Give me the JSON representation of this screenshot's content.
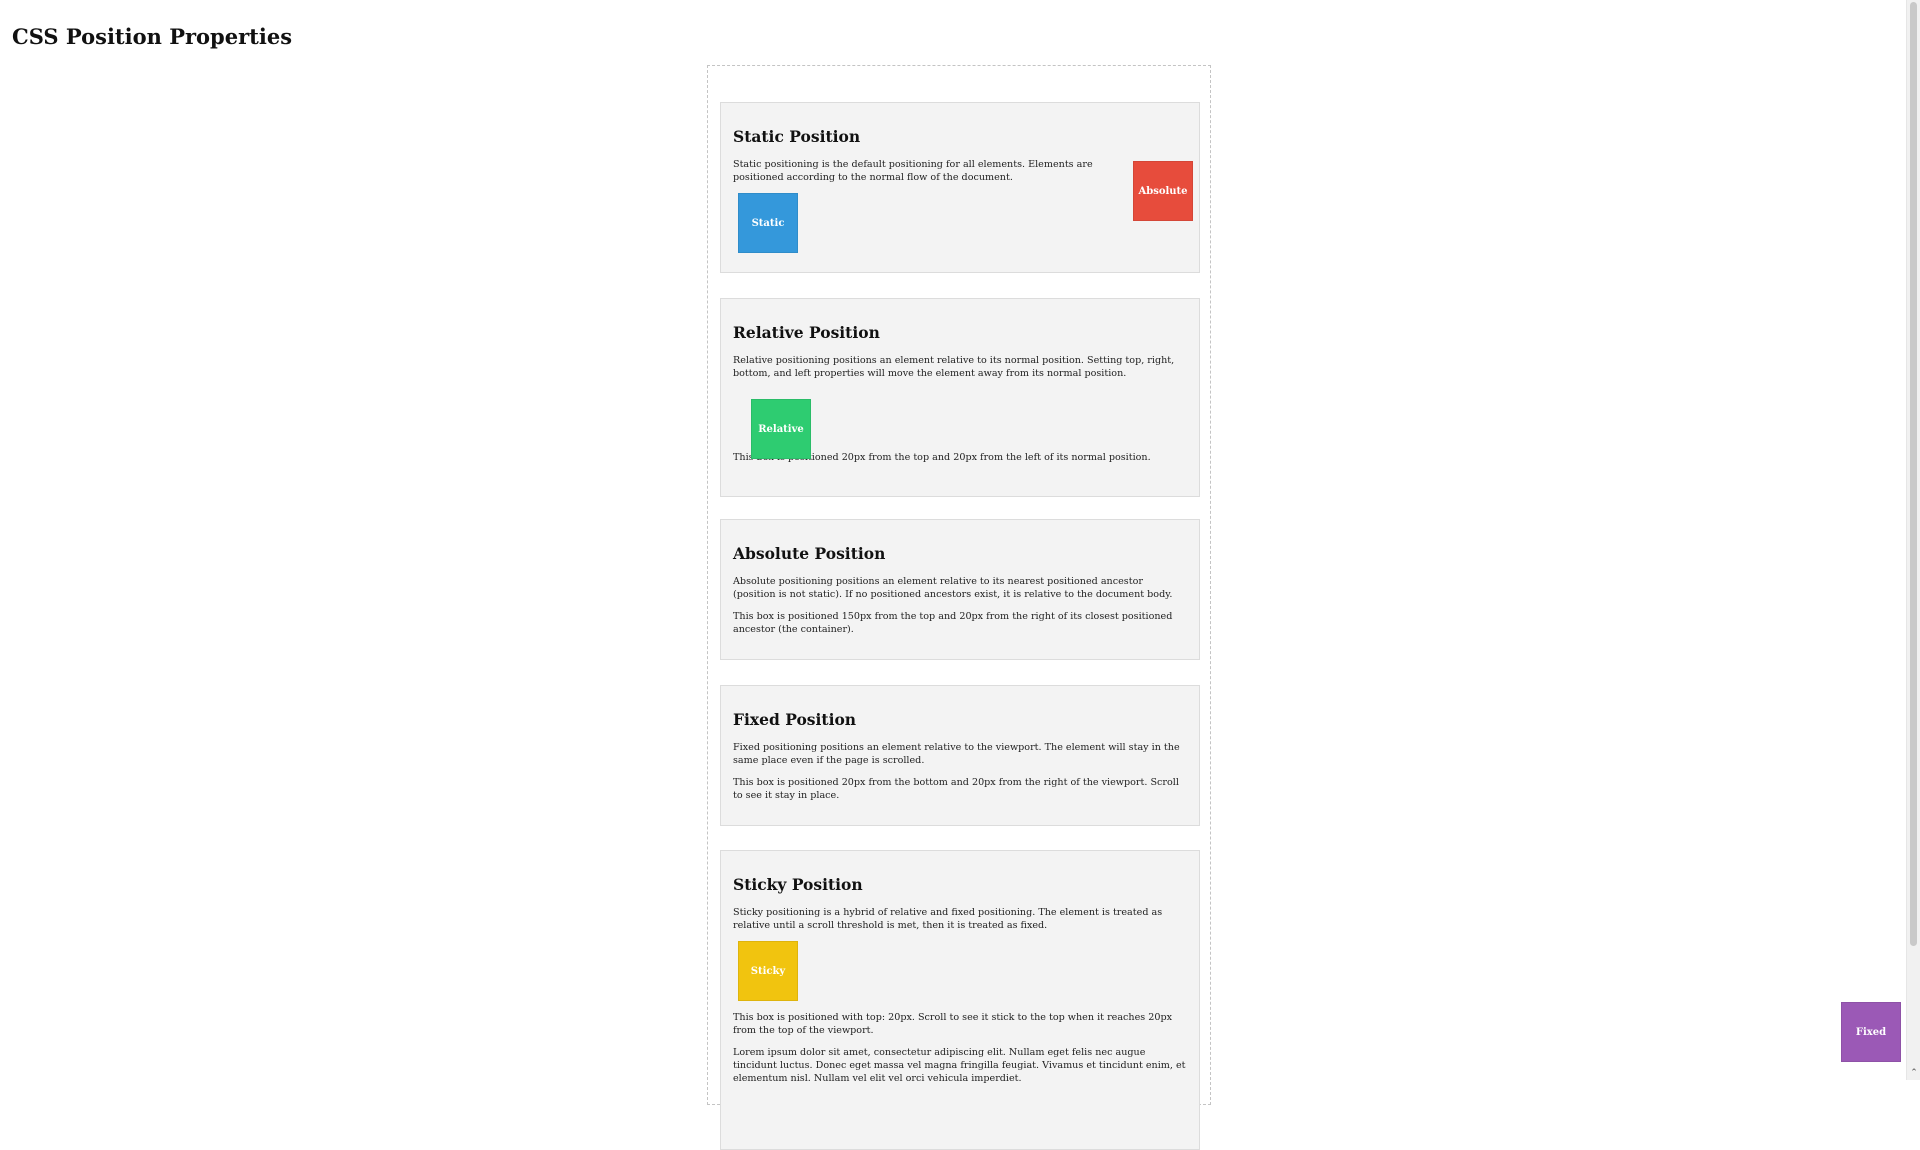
{
  "page": {
    "title": "CSS Position Properties"
  },
  "sections": {
    "static": {
      "heading": "Static Position",
      "desc": "Static positioning is the default positioning for all elements. Elements are positioned according to the normal flow of the document.",
      "box_label": "Static"
    },
    "relative": {
      "heading": "Relative Position",
      "desc": "Relative positioning positions an element relative to its normal position. Setting top, right, bottom, and left properties will move the element away from its normal position.",
      "box_label": "Relative",
      "note": "This box is positioned 20px from the top and 20px from the left of its normal position."
    },
    "absolute": {
      "heading": "Absolute Position",
      "desc": "Absolute positioning positions an element relative to its nearest positioned ancestor (position is not static). If no positioned ancestors exist, it is relative to the document body.",
      "note": "This box is positioned 150px from the top and 20px from the right of its closest positioned ancestor (the container).",
      "box_label": "Absolute"
    },
    "fixed": {
      "heading": "Fixed Position",
      "desc": "Fixed positioning positions an element relative to the viewport. The element will stay in the same place even if the page is scrolled.",
      "note": "This box is positioned 20px from the bottom and 20px from the right of the viewport. Scroll to see it stay in place.",
      "box_label": "Fixed"
    },
    "sticky": {
      "heading": "Sticky Position",
      "desc": "Sticky positioning is a hybrid of relative and fixed positioning. The element is treated as relative until a scroll threshold is met, then it is treated as fixed.",
      "box_label": "Sticky",
      "note": "This box is positioned with top: 20px. Scroll to see it stick to the top when it reaches 20px from the top of the viewport.",
      "lorem": "Lorem ipsum dolor sit amet, consectetur adipiscing elit. Nullam eget felis nec augue tincidunt luctus. Donec eget massa vel magna fringilla feugiat. Vivamus et tincidunt enim, et elementum nisl. Nullam vel elit vel orci vehicula imperdiet."
    }
  },
  "colors": {
    "static": "#3498db",
    "relative": "#2ecc71",
    "absolute": "#e74c3c",
    "fixed": "#9b59b6",
    "sticky": "#f1c40f"
  }
}
